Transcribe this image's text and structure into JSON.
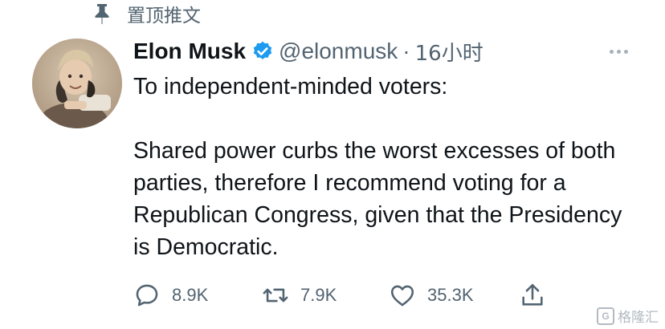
{
  "pinned": {
    "label": "置顶推文",
    "icon": "pin-icon"
  },
  "author": {
    "name": "Elon Musk",
    "handle": "@elonmusk",
    "separator": "·",
    "time": "16小时",
    "verified_color": "#1d9bf0"
  },
  "tweet": {
    "line1": "To independent-minded voters:",
    "line2": "Shared power curbs the worst excesses of both parties, therefore I recommend voting for a Republican Congress, given that the Presidency is Democratic."
  },
  "actions": {
    "reply_count": "8.9K",
    "retweet_count": "7.9K",
    "like_count": "35.3K"
  },
  "watermark": {
    "logo": "G",
    "text": "格隆汇"
  },
  "colors": {
    "text": "#0f1419",
    "secondary": "#536471",
    "accent": "#1d9bf0"
  }
}
